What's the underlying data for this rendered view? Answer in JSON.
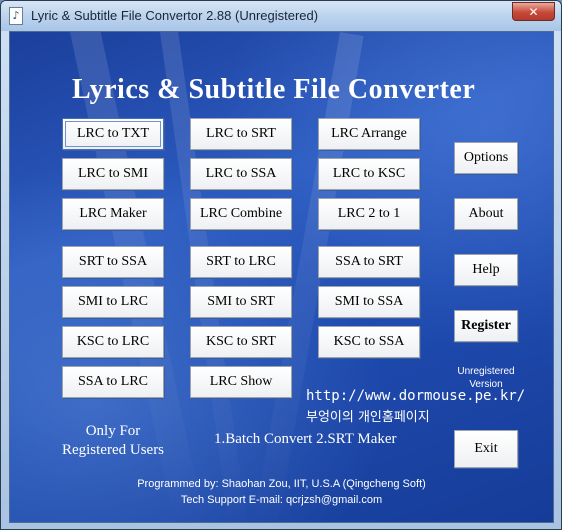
{
  "window": {
    "title": "Lyric & Subtitle File Convertor 2.88 (Unregistered)",
    "close_label": "✕"
  },
  "header": {
    "title": "Lyrics & Subtitle File Converter"
  },
  "buttons": {
    "lrc_to_txt": "LRC to TXT",
    "lrc_to_srt": "LRC to SRT",
    "lrc_arrange": "LRC Arrange",
    "lrc_to_smi": "LRC to SMI",
    "lrc_to_ssa": "LRC to SSA",
    "lrc_to_ksc": "LRC to KSC",
    "lrc_maker": "LRC Maker",
    "lrc_combine": "LRC Combine",
    "lrc_2_to_1": "LRC 2 to 1",
    "srt_to_ssa": "SRT to SSA",
    "srt_to_lrc": "SRT to LRC",
    "ssa_to_srt": "SSA to SRT",
    "smi_to_lrc": "SMI to LRC",
    "smi_to_srt": "SMI to SRT",
    "smi_to_ssa": "SMI to SSA",
    "ksc_to_lrc": "KSC to LRC",
    "ksc_to_srt": "KSC to SRT",
    "ksc_to_ssa": "KSC to SSA",
    "ssa_to_lrc": "SSA to LRC",
    "lrc_show": "LRC Show",
    "options": "Options",
    "about": "About",
    "help": "Help",
    "register": "Register",
    "exit": "Exit"
  },
  "status": {
    "unregistered_line1": "Unregistered",
    "unregistered_line2": "Version"
  },
  "website": {
    "url": "http://www.dormouse.pe.kr/",
    "korean": "부엉이의 개인홈페이지"
  },
  "registered_note": {
    "line1": "Only For",
    "line2": "Registered Users"
  },
  "features": "1.Batch Convert  2.SRT Maker",
  "credits": {
    "programmer": "Programmed by: Shaohan Zou, IIT, U.S.A (Qingcheng Soft)",
    "support": "Tech Support E-mail: qcrjzsh@gmail.com"
  }
}
